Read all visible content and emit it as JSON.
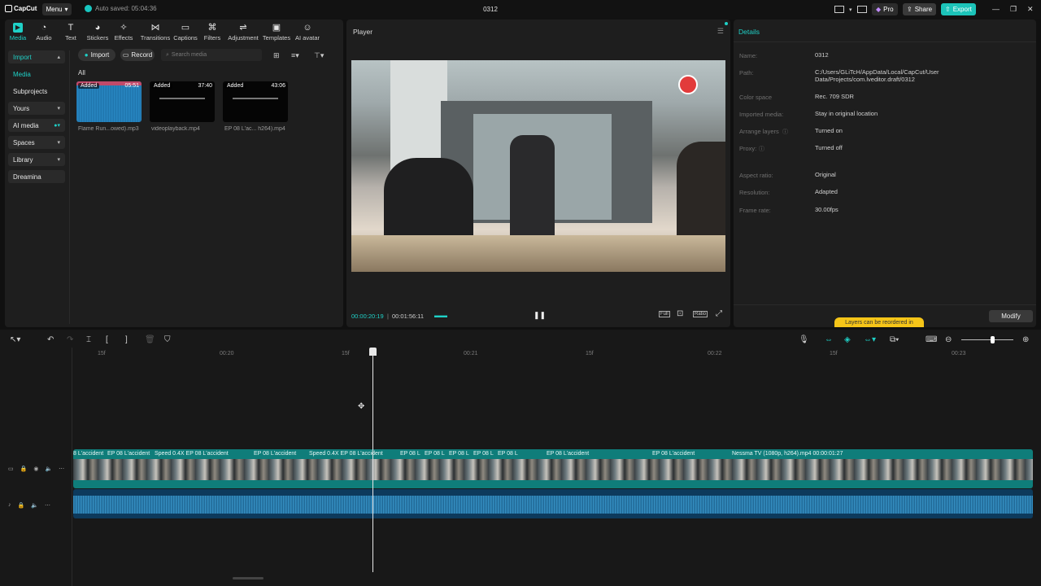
{
  "titlebar": {
    "app_name": "CapCut",
    "menu_label": "Menu",
    "autosave": "Auto saved: 05:04:36",
    "project_title": "0312",
    "pro_label": "Pro",
    "share_label": "Share",
    "export_label": "Export"
  },
  "media_tabs": [
    {
      "label": "Media",
      "icon": "media-icon"
    },
    {
      "label": "Audio",
      "icon": "audio-icon"
    },
    {
      "label": "Text",
      "icon": "text-icon"
    },
    {
      "label": "Stickers",
      "icon": "stickers-icon"
    },
    {
      "label": "Effects",
      "icon": "effects-icon"
    },
    {
      "label": "Transitions",
      "icon": "transitions-icon"
    },
    {
      "label": "Captions",
      "icon": "captions-icon"
    },
    {
      "label": "Filters",
      "icon": "filters-icon"
    },
    {
      "label": "Adjustment",
      "icon": "adjustment-icon"
    },
    {
      "label": "Templates",
      "icon": "templates-icon"
    },
    {
      "label": "AI avatar",
      "icon": "ai-avatar-icon"
    }
  ],
  "sidenav": {
    "import": "Import",
    "media": "Media",
    "subprojects": "Subprojects",
    "yours": "Yours",
    "ai_media": "AI media",
    "spaces": "Spaces",
    "library": "Library",
    "dreamina": "Dreamina"
  },
  "media_toolbar": {
    "import_label": "Import",
    "record_label": "Record",
    "search_placeholder": "Search media",
    "filter_all": "All"
  },
  "media_items": [
    {
      "tag": "Added",
      "duration": "05:51",
      "name": "Flame Run...owed).mp3"
    },
    {
      "tag": "Added",
      "duration": "37:40",
      "name": "videoplayback.mp4"
    },
    {
      "tag": "Added",
      "duration": "43:06",
      "name": "EP 08 L'ac... h264).mp4"
    }
  ],
  "player": {
    "title": "Player",
    "current_time": "00:00:20:19",
    "total_time": "00:01:56:11",
    "full_label": "Full",
    "ratio_label": "Ratio"
  },
  "details": {
    "title": "Details",
    "rows": [
      {
        "label": "Name:",
        "value": "0312"
      },
      {
        "label": "Path:",
        "value": "C:/Users/GLiTcH/AppData/Local/CapCut/User Data/Projects/com.lveditor.draft/0312"
      },
      {
        "label": "Color space",
        "value": "Rec. 709 SDR"
      },
      {
        "label": "Imported media:",
        "value": "Stay in original location"
      },
      {
        "label": "Arrange layers",
        "value": "Turned on"
      },
      {
        "label": "Proxy:",
        "value": "Turned off"
      },
      {
        "label": "Aspect ratio:",
        "value": "Original"
      },
      {
        "label": "Resolution:",
        "value": "Adapted"
      },
      {
        "label": "Frame rate:",
        "value": "30.00fps"
      }
    ],
    "tooltip": "Layers can be reordered in",
    "modify_label": "Modify"
  },
  "timeline": {
    "ruler": [
      "15f",
      "00:20",
      "15f",
      "00:21",
      "15f",
      "00:22",
      "15f",
      "00:23"
    ],
    "clips": [
      {
        "label": "8 L'accident"
      },
      {
        "label": "EP 08 L'accident"
      },
      {
        "label": "Speed 0.4X  EP 08 L'accident"
      },
      {
        "label": "EP 08 L'accident"
      },
      {
        "label": "Speed 0.4X  EP 08 L'accident"
      },
      {
        "label": "EP 08 L"
      },
      {
        "label": "EP 08 L"
      },
      {
        "label": "EP 08 L"
      },
      {
        "label": "EP 08 L"
      },
      {
        "label": "EP 08 L"
      },
      {
        "label": "EP 08 L'accident"
      },
      {
        "label": "EP 08 L'accident"
      },
      {
        "label": "Nessma TV (1080p, h264).mp4  00:00:01:27"
      }
    ]
  }
}
